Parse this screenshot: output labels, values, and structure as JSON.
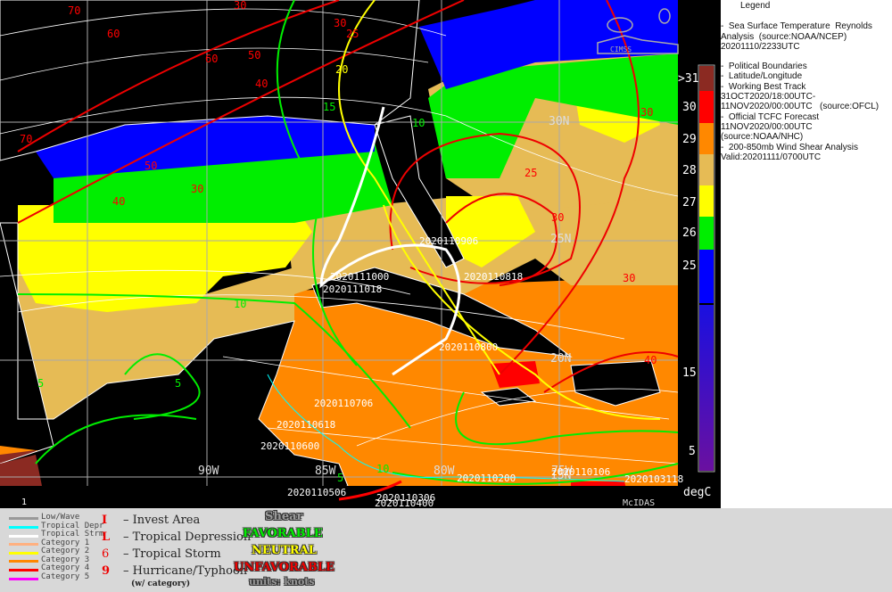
{
  "legend": {
    "title": "Legend",
    "lines": [
      "-  Sea Surface Temperature  Reynolds",
      "Analysis  (source:NOAA/NCEP)",
      "20201110/2233UTC",
      "-  Political Boundaries",
      "-  Latitude/Longitude",
      "-  Working Best Track",
      "31OCT2020/18:00UTC-",
      "11NOV2020/00:00UTC   (source:OFCL)",
      "-  Official TCFC Forecast",
      "11NOV2020/00:00UTC",
      "(source:NOAA/NHC)",
      "-  200-850mb Wind Shear Analysis",
      "Valid:20201111/0700UTC"
    ]
  },
  "colorbar": {
    "unit": "degC",
    "labels": [
      ">31",
      "30",
      "29",
      "28",
      "27",
      "26",
      "25",
      "15",
      "5"
    ],
    "colors": [
      "#8b2a22",
      "#ff0000",
      "#ff8800",
      "#e6bb55",
      "#ffff00",
      "#00ee00",
      "#0000ff",
      "#1a10e0",
      "#6a10a0"
    ]
  },
  "map": {
    "grid_labels": [
      "30N",
      "25N",
      "20N",
      "15N",
      "90W",
      "85W",
      "80W",
      "75W"
    ],
    "shear_labels": [
      "70",
      "60",
      "60",
      "50",
      "40",
      "30",
      "25",
      "20",
      "15",
      "10",
      "10",
      "5",
      "5",
      "5",
      "10",
      "30",
      "25",
      "30",
      "30",
      "40",
      "30",
      "70",
      "50",
      "40",
      "30"
    ],
    "track_labels": [
      "2020110906",
      "2020111000",
      "2020111018",
      "2020110818",
      "2020110800",
      "2020110706",
      "2020110618",
      "2020110600",
      "2020110506",
      "2020110400",
      "2020110306",
      "2020110200",
      "2020110106",
      "2020103118"
    ],
    "frame_number": "1",
    "software": "McIDAS",
    "logo_text": "CIMSS"
  },
  "track_key": [
    {
      "label": "Low/Wave",
      "color": "#999999"
    },
    {
      "label": "Tropical Depr",
      "color": "#00ffff"
    },
    {
      "label": "Tropical Strm",
      "color": "#ffffff"
    },
    {
      "label": "Category 1",
      "color": "#ffb080"
    },
    {
      "label": "Category 2",
      "color": "#ffff00"
    },
    {
      "label": "Category 3",
      "color": "#ff8800"
    },
    {
      "label": "Category 4",
      "color": "#ff0000"
    },
    {
      "label": "Category 5",
      "color": "#ff00ff"
    }
  ],
  "symbol_key": [
    {
      "glyph": "I",
      "label": "– Invest Area"
    },
    {
      "glyph": "L",
      "label": "– Tropical Depression"
    },
    {
      "glyph": "6",
      "label": "– Tropical Storm"
    },
    {
      "glyph": "9",
      "label": "– Hurricane/Typhoon"
    }
  ],
  "symbol_note": "(w/ category)",
  "shear_key": {
    "title": "Shear",
    "items": [
      {
        "label": "FAVORABLE",
        "color": "#00ee00"
      },
      {
        "label": "NEUTRAL",
        "color": "#ffff00"
      },
      {
        "label": "UNFAVORABLE",
        "color": "#ee0000"
      }
    ],
    "units": "units: knots"
  }
}
